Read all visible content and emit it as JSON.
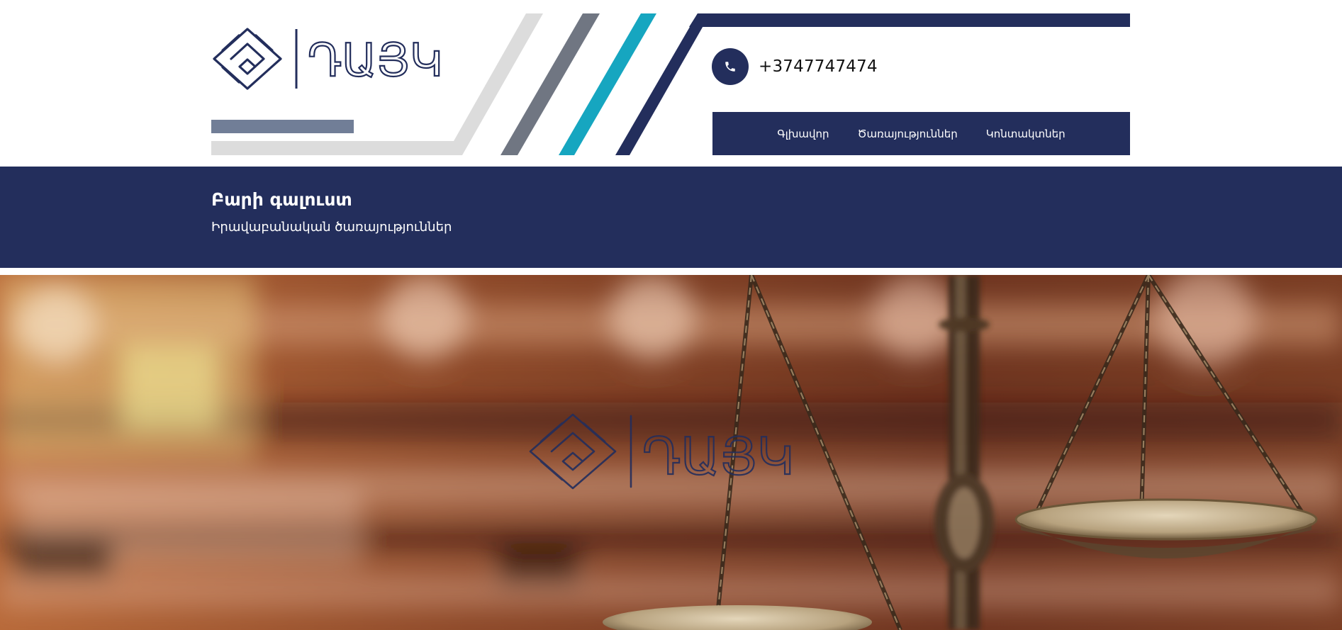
{
  "header": {
    "logo_text": "ԴԱՅԿ",
    "phone": "+3747747474",
    "nav": [
      {
        "label": "Գլխավոր"
      },
      {
        "label": "Ծառայություններ"
      },
      {
        "label": "Կոնտակտներ"
      }
    ]
  },
  "welcome": {
    "title": "Բարի գալուստ",
    "subtitle": "Իրավաբանական ծառայություններ"
  },
  "hero": {
    "watermark_text": "ԴԱՅԿ",
    "image": "scales-of-justice-photo"
  },
  "colors": {
    "navy": "#232e5c",
    "teal": "#16a6c0",
    "slate": "#707682",
    "light_gray": "#dcdcdc",
    "steel_bar": "#717e97"
  },
  "icons": {
    "phone": "phone-icon",
    "logo": "maze-square-logo-icon"
  }
}
